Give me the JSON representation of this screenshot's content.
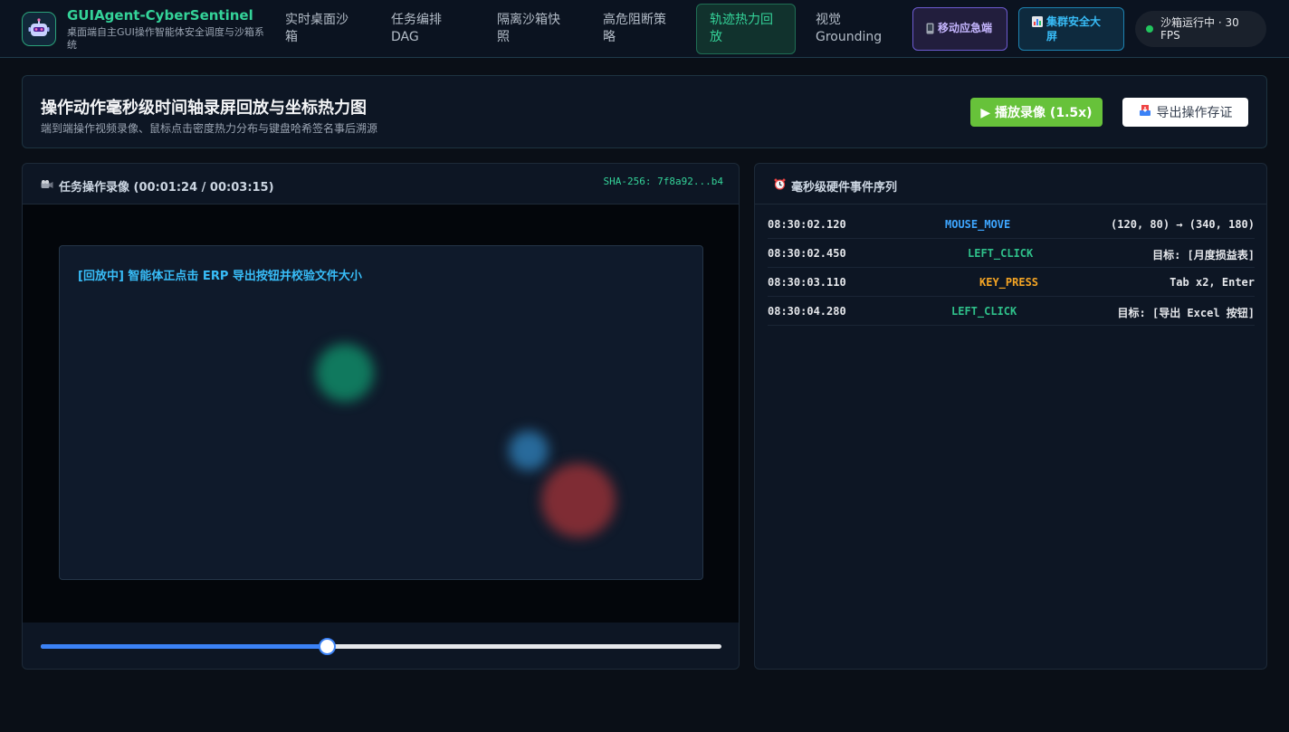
{
  "header": {
    "brand_title": "GUIAgent-CyberSentinel",
    "brand_subtitle": "桌面端自主GUI操作智能体安全调度与沙箱系统",
    "logo_icon": "robot-icon",
    "nav": [
      {
        "label": "实时桌面沙箱",
        "active": false
      },
      {
        "label": "任务编排DAG",
        "active": false
      },
      {
        "label": "隔离沙箱快照",
        "active": false
      },
      {
        "label": "高危阻断策略",
        "active": false
      },
      {
        "label": "轨迹热力回放",
        "active": true
      },
      {
        "label": "视觉Grounding",
        "active": false
      }
    ],
    "mobile_button": "移动应急端",
    "mobile_icon": "mobile-phone-icon",
    "dashboard_button": "集群安全大屏",
    "dashboard_icon": "bar-chart-icon",
    "status": "沙箱运行中 · 30 FPS"
  },
  "title_card": {
    "title": "操作动作毫秒级时间轴录屏回放与坐标热力图",
    "subtitle": "端到端操作视频录像、鼠标点击密度热力分布与键盘哈希签名事后溯源",
    "play_button": "▶ 播放录像 (1.5x)",
    "export_button": "导出操作存证",
    "export_icon": "inbox-tray-icon"
  },
  "video": {
    "title": "任务操作录像 (00:01:24 / 00:03:15)",
    "title_icon": "video-camera-icon",
    "sha": "SHA-256: 7f8a92...b4",
    "caption": "[回放中] 智能体正点击 ERP 导出按钮并校验文件大小",
    "progress": 0.42
  },
  "events": {
    "title": "毫秒级硬件事件序列",
    "title_icon": "alarm-clock-icon",
    "items": [
      {
        "time": "08:30:02.120",
        "type": "MOUSE_MOVE",
        "detail": "(120, 80) → (340, 180)",
        "color": "#3ea6ff"
      },
      {
        "time": "08:30:02.450",
        "type": "LEFT_CLICK",
        "detail": "目标: [月度损益表]",
        "color": "#2fc08a"
      },
      {
        "time": "08:30:03.110",
        "type": "KEY_PRESS",
        "detail": "Tab x2, Enter",
        "color": "#f5a524"
      },
      {
        "time": "08:30:04.280",
        "type": "LEFT_CLICK",
        "detail": "目标: [导出 Excel 按钮]",
        "color": "#2fc08a"
      }
    ]
  }
}
